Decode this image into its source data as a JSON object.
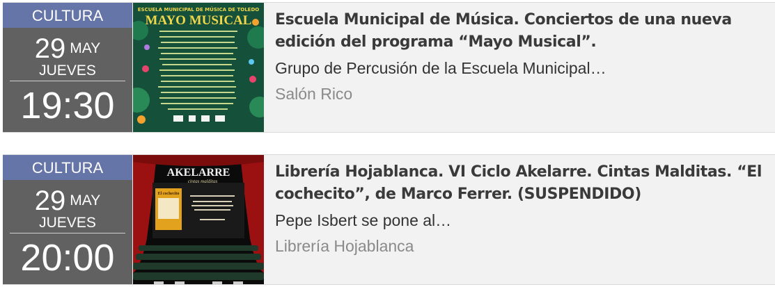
{
  "events": [
    {
      "category": "CULTURA",
      "day": "29",
      "month": "MAY",
      "weekday": "JUEVES",
      "time": "19:30",
      "title": "Escuela Municipal de Música. Conciertos de una nueva edición del programa “Mayo Musical”.",
      "description": "Grupo de Percusión de la Escuela Municipal…",
      "venue": "Salón Rico",
      "poster": {
        "small_heading": "ESCUELA MUNICIPAL DE MÚSICA DE TOLEDO",
        "heading": "MAYO MUSICAL",
        "background_color": "#15503a",
        "accent_color": "#f0d64a"
      }
    },
    {
      "category": "CULTURA",
      "day": "29",
      "month": "MAY",
      "weekday": "JUEVES",
      "time": "20:00",
      "title": "Librería Hojablanca. VI Ciclo Akelarre. Cintas Malditas. “El cochecito”, de Marco Ferrer. (SUSPENDIDO)",
      "description": "Pepe Isbert se pone al…",
      "venue": "Librería Hojablanca",
      "poster": {
        "heading": "AKELARRE",
        "subheading": "cintas malditas",
        "film": "El cochecito",
        "background_color": "#0b0b0b",
        "curtain_color": "#9b1010"
      }
    }
  ]
}
